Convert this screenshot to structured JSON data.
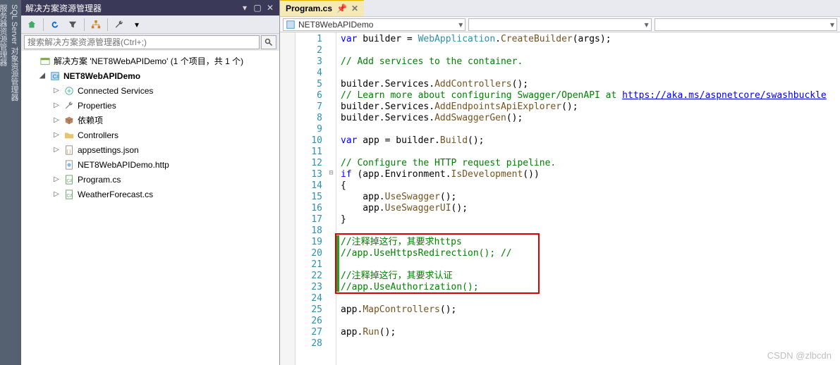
{
  "leftRail": {
    "items": [
      "SQL Server 对象资源管理器",
      "服务器资源管理器"
    ]
  },
  "solutionPanel": {
    "title": "解决方案资源管理器",
    "searchPlaceholder": "搜索解决方案资源管理器(Ctrl+;)",
    "solutionLine": "解决方案 'NET8WebAPIDemo' (1 个项目，共 1 个)",
    "project": "NET8WebAPIDemo",
    "children": [
      {
        "icon": "link",
        "label": "Connected Services"
      },
      {
        "icon": "wrench",
        "label": "Properties"
      },
      {
        "icon": "pkg",
        "label": "依赖项"
      },
      {
        "icon": "folder",
        "label": "Controllers"
      },
      {
        "icon": "json",
        "label": "appsettings.json"
      },
      {
        "icon": "http",
        "label": "NET8WebAPIDemo.http"
      },
      {
        "icon": "cs",
        "label": "Program.cs"
      },
      {
        "icon": "cs",
        "label": "WeatherForecast.cs"
      }
    ]
  },
  "editor": {
    "tabLabel": "Program.cs",
    "comboMain": "NET8WebAPIDemo",
    "lineStart": 1,
    "lineEnd": 28,
    "redbox": {
      "startLine": 19,
      "endLine": 23
    },
    "code": [
      [
        [
          "kw",
          "var"
        ],
        [
          "txt",
          " builder = "
        ],
        [
          "typ",
          "WebApplication"
        ],
        [
          "txt",
          "."
        ],
        [
          "mtd",
          "CreateBuilder"
        ],
        [
          "txt",
          "(args);"
        ]
      ],
      [],
      [
        [
          "com",
          "// Add services to the container."
        ]
      ],
      [],
      [
        [
          "txt",
          "builder.Services."
        ],
        [
          "mtd",
          "AddControllers"
        ],
        [
          "txt",
          "();"
        ]
      ],
      [
        [
          "com",
          "// Learn more about configuring Swagger/OpenAPI at "
        ],
        [
          "url",
          "https://aka.ms/aspnetcore/swashbuckle"
        ]
      ],
      [
        [
          "txt",
          "builder.Services."
        ],
        [
          "mtd",
          "AddEndpointsApiExplorer"
        ],
        [
          "txt",
          "();"
        ]
      ],
      [
        [
          "txt",
          "builder.Services."
        ],
        [
          "mtd",
          "AddSwaggerGen"
        ],
        [
          "txt",
          "();"
        ]
      ],
      [],
      [
        [
          "kw",
          "var"
        ],
        [
          "txt",
          " app = builder."
        ],
        [
          "mtd",
          "Build"
        ],
        [
          "txt",
          "();"
        ]
      ],
      [],
      [
        [
          "com",
          "// Configure the HTTP request pipeline."
        ]
      ],
      [
        [
          "kw",
          "if"
        ],
        [
          "txt",
          " (app.Environment."
        ],
        [
          "mtd",
          "IsDevelopment"
        ],
        [
          "txt",
          "())"
        ]
      ],
      [
        [
          "txt",
          "{"
        ]
      ],
      [
        [
          "txt",
          "    app."
        ],
        [
          "mtd",
          "UseSwagger"
        ],
        [
          "txt",
          "();"
        ]
      ],
      [
        [
          "txt",
          "    app."
        ],
        [
          "mtd",
          "UseSwaggerUI"
        ],
        [
          "txt",
          "();"
        ]
      ],
      [
        [
          "txt",
          "}"
        ]
      ],
      [],
      [
        [
          "com",
          "//注释掉这行，其要求https"
        ]
      ],
      [
        [
          "com",
          "//app.UseHttpsRedirection(); //"
        ]
      ],
      [],
      [
        [
          "com",
          "//注释掉这行，其要求认证"
        ]
      ],
      [
        [
          "com",
          "//app.UseAuthorization();"
        ]
      ],
      [],
      [
        [
          "txt",
          "app."
        ],
        [
          "mtd",
          "MapControllers"
        ],
        [
          "txt",
          "();"
        ]
      ],
      [],
      [
        [
          "txt",
          "app."
        ],
        [
          "mtd",
          "Run"
        ],
        [
          "txt",
          "();"
        ]
      ],
      []
    ]
  },
  "watermark": "CSDN @zlbcdn"
}
